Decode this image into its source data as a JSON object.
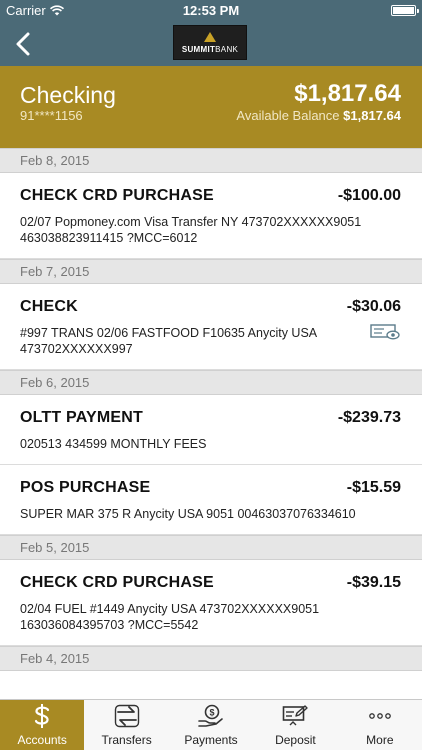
{
  "status": {
    "carrier": "Carrier",
    "time": "12:53 PM"
  },
  "nav": {
    "back_icon": "chevron-left-icon",
    "logo_text_bold": "SUMMIT",
    "logo_text_regular": "BANK"
  },
  "account": {
    "name": "Checking",
    "number": "91****1156",
    "balance": "$1,817.64",
    "available_label": "Available Balance",
    "available_amount": "$1,817.64"
  },
  "groups": [
    {
      "date": "Feb 8, 2015",
      "transactions": [
        {
          "title": "CHECK CRD PURCHASE",
          "amount": "-$100.00",
          "desc": "02/07 Popmoney.com Visa Transfer NY 473702XXXXXX9051 463038823911415 ?MCC=6012"
        }
      ]
    },
    {
      "date": "Feb 7, 2015",
      "transactions": [
        {
          "title": "CHECK",
          "amount": "-$30.06",
          "desc": "#997 TRANS 02/06 FASTFOOD F10635 Anycity USA 473702XXXXXX997",
          "icon": "check-image-icon"
        }
      ]
    },
    {
      "date": "Feb 6, 2015",
      "transactions": [
        {
          "title": "OLTT PAYMENT",
          "amount": "-$239.73",
          "desc": "020513 434599 MONTHLY FEES"
        },
        {
          "title": "POS PURCHASE",
          "amount": "-$15.59",
          "desc": "SUPER MAR 375 R Anycity USA 9051 00463037076334610"
        }
      ]
    },
    {
      "date": "Feb 5, 2015",
      "transactions": [
        {
          "title": "CHECK CRD PURCHASE",
          "amount": "-$39.15",
          "desc": "02/04 FUEL #1449 Anycity USA 473702XXXXXX9051 163036084395703 ?MCC=5542"
        }
      ]
    },
    {
      "date": "Feb 4, 2015",
      "transactions": []
    }
  ],
  "tabs": [
    {
      "label": "Accounts",
      "icon": "dollar-icon",
      "active": true
    },
    {
      "label": "Transfers",
      "icon": "transfer-arrows-icon",
      "active": false
    },
    {
      "label": "Payments",
      "icon": "payment-hand-icon",
      "active": false
    },
    {
      "label": "Deposit",
      "icon": "check-deposit-icon",
      "active": false
    },
    {
      "label": "More",
      "icon": "more-dots-icon",
      "active": false
    }
  ],
  "colors": {
    "nav": "#4b6a77",
    "accent": "#a88a23"
  }
}
